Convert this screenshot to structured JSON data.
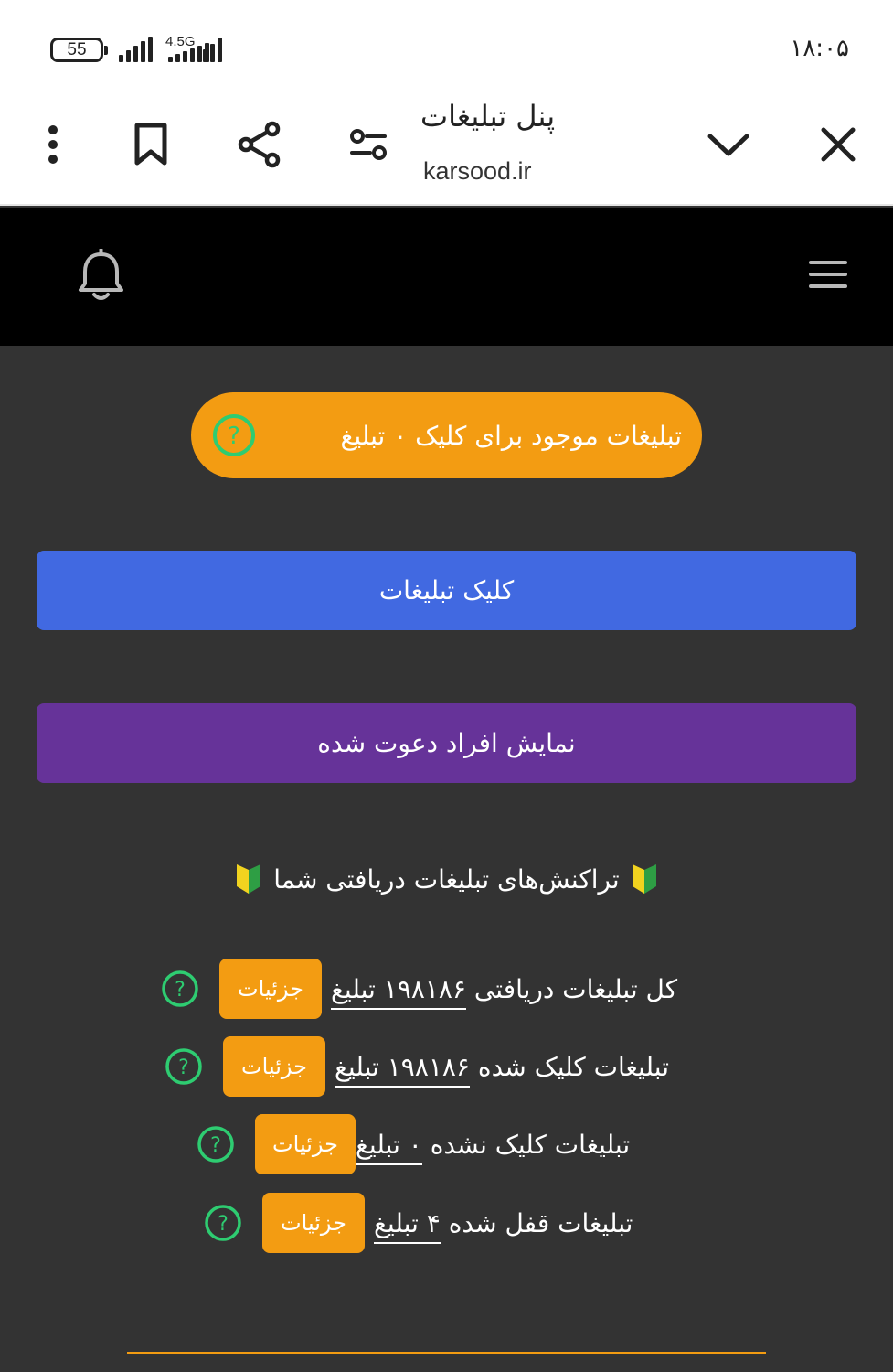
{
  "status_bar": {
    "battery": "55",
    "network": "4.5G",
    "time": "۱۸:۰۵"
  },
  "browser": {
    "title": "پنل تبلیغات",
    "url": "karsood.ir",
    "icons": [
      "more-vert-icon",
      "bookmark-icon",
      "share-icon",
      "page-settings-icon",
      "chevron-down-icon",
      "close-icon"
    ]
  },
  "header": {
    "icons": [
      "bell-icon",
      "hamburger-menu-icon"
    ]
  },
  "ads_available": {
    "label": "تبلیغات موجود برای کلیک ۰ تبلیغ"
  },
  "buttons": {
    "click_ads": "کلیک تبلیغات",
    "show_invited": "نمایش افراد دعوت شده"
  },
  "section": {
    "title": "تراکنش‌های تبلیغات دریافتی شما"
  },
  "stats": [
    {
      "label": "کل تبلیغات دریافتی",
      "value": "۱۹۸۱۸۶ تبلیغ",
      "details": "جزئیات"
    },
    {
      "label": "تبلیغات کلیک شده",
      "value": "۱۹۸۱۸۶ تبلیغ",
      "details": "جزئیات"
    },
    {
      "label": "تبلیغات کلیک نشده",
      "value": "۰ تبلیغ",
      "details": "جزئیات"
    },
    {
      "label": "تبلیغات قفل شده",
      "value": "۴ تبلیغ",
      "details": "جزئیات"
    }
  ],
  "colors": {
    "accent_orange": "#f39c12",
    "button_blue": "#4169e1",
    "button_purple": "#663399",
    "help_green": "#2ecc71",
    "background": "#333333"
  }
}
